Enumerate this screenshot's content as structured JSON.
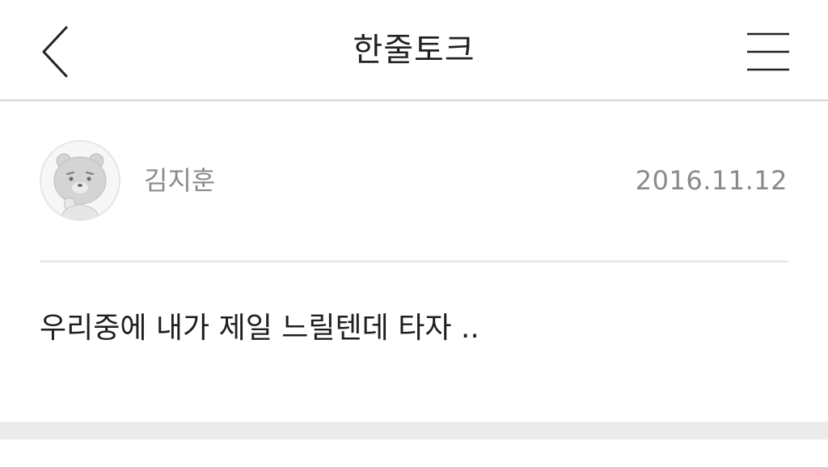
{
  "header": {
    "back_icon": "chevron-left-icon",
    "title": "한줄토크",
    "menu_icon": "hamburger-menu-icon"
  },
  "post": {
    "author": {
      "name": "김지훈",
      "avatar_icon": "bear-character-avatar"
    },
    "date": "2016.11.12",
    "body": "우리중에 내가 제일 느릴텐데 타자 .."
  },
  "colors": {
    "divider": "#d4d4d4",
    "meta_text": "#8a8a8a",
    "body_text": "#1e1e1e",
    "footer_band": "#ebebeb"
  }
}
